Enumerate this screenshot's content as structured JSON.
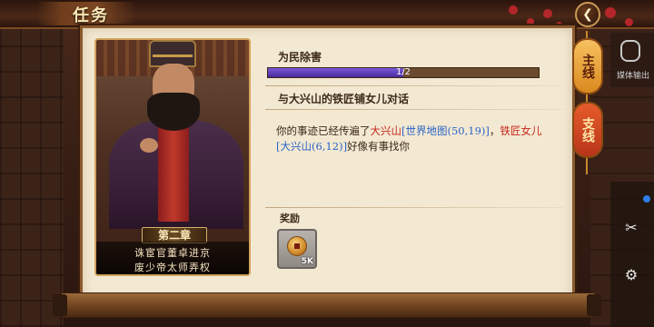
{
  "header": {
    "title": "任务"
  },
  "portrait_card": {
    "chapter_label": "第二章",
    "caption_line1": "诛宦官董卓进京",
    "caption_line2": "废少帝太师弄权"
  },
  "quest": {
    "name": "为民除害",
    "progress": {
      "current": 1,
      "total": 2,
      "text": "1/2"
    },
    "objective": "与大兴山的铁匠铺女儿对话",
    "description": {
      "part1": "你的事迹已经传遍了",
      "place1": "大兴山",
      "link1": "[世界地图(50,19)]",
      "sep": "，",
      "npc": "铁匠女儿",
      "link2": "[大兴山(6,12)]",
      "part2": "好像有事找你"
    }
  },
  "rewards": {
    "label": "奖励",
    "items": [
      {
        "icon": "copper-coin-icon",
        "quantity": "5K"
      }
    ]
  },
  "side_tabs": {
    "main": "主线",
    "branch": "支线"
  },
  "floating_tool": {
    "label": "媒体输出"
  },
  "colors": {
    "accent_red": "#c8281e",
    "link_blue": "#2a63c7",
    "progress_purple": "#5a3ab8"
  }
}
